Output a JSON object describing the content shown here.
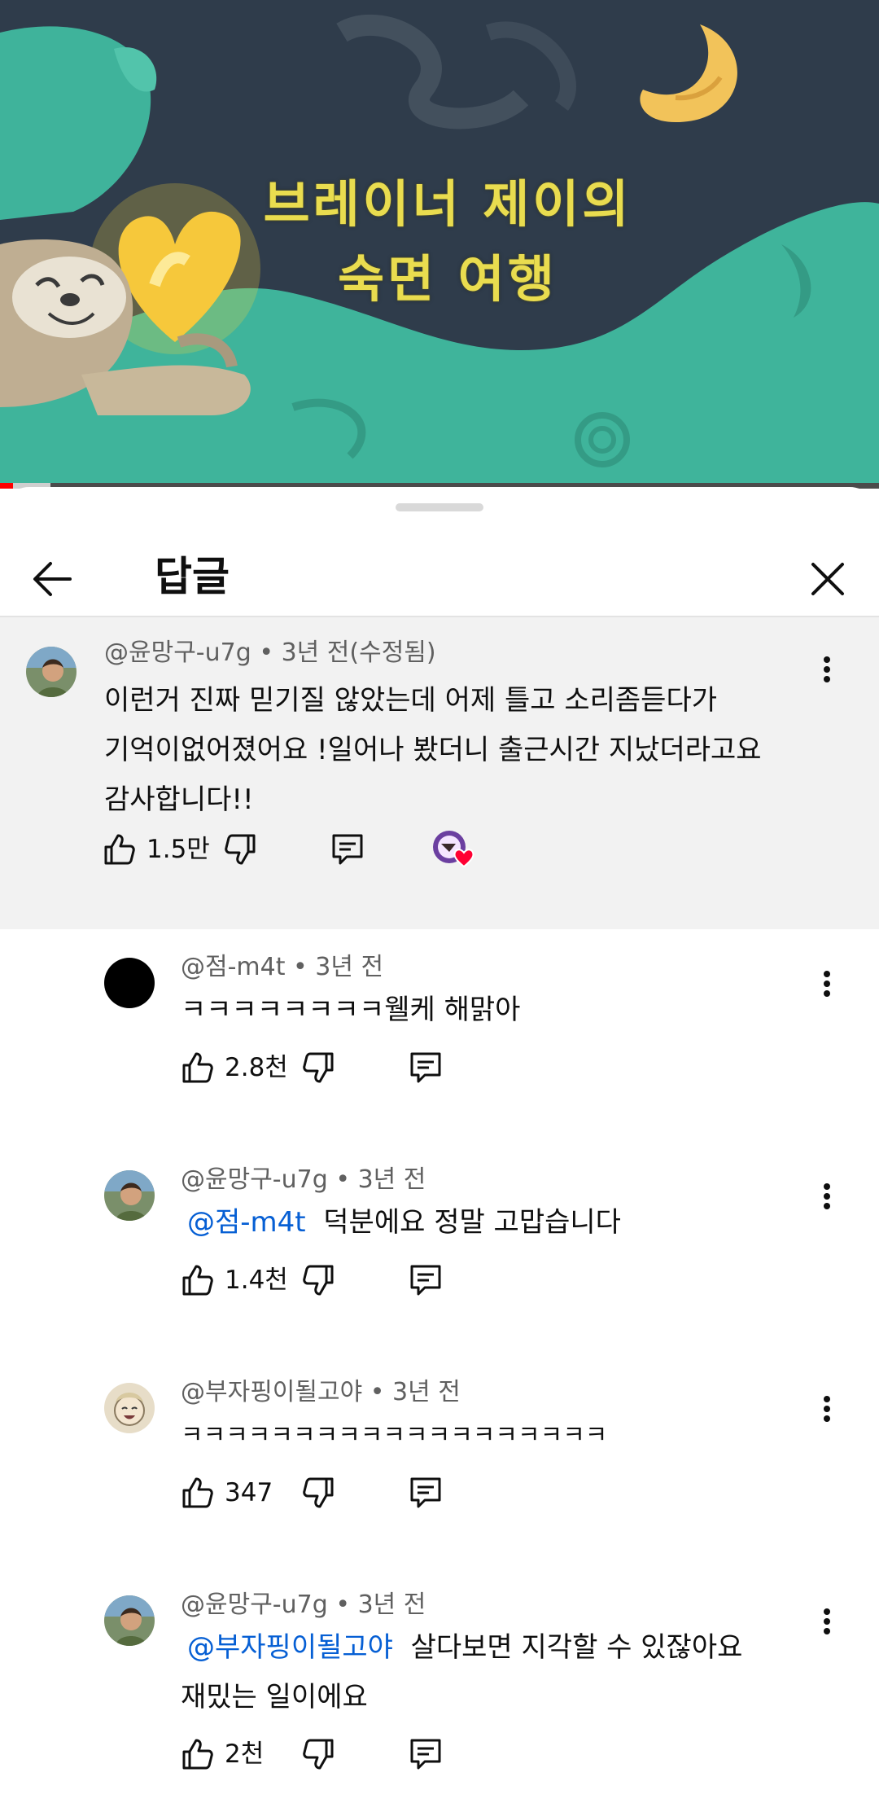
{
  "video": {
    "title_line1": "브레이너 제이의",
    "title_line2": "숙면 여행",
    "progress_percent": 2
  },
  "sheet": {
    "title": "답글"
  },
  "parent_comment": {
    "author": "@윤망구-u7g",
    "time": "3년 전(수정됨)",
    "lines": [
      "이런거 진짜 믿기질 않았는데 어제 틀고 소리좀듣다가",
      "기억이없어졌어요 !일어나 봤더니 출근시간 지났더라고요",
      "감사합니다!!"
    ],
    "likes": "1.5만"
  },
  "replies": [
    {
      "author": "@점-m4t",
      "time": "3년 전",
      "mention": "",
      "line1": "ㅋㅋㅋㅋㅋㅋㅋㅋ웰케 해맑아",
      "line2": "",
      "likes": "2.8천"
    },
    {
      "author": "@윤망구-u7g",
      "time": "3년 전",
      "mention": "@점-m4t",
      "line1": "덕분에요 정말 고맙습니다",
      "line2": "",
      "likes": "1.4천"
    },
    {
      "author": "@부자핑이될고야",
      "time": "3년 전",
      "mention": "",
      "line1": "ㅋㅋㅋㅋㅋㅋㅋㅋㅋㅋㅋㅋㅋㅋㅋㅋㅋㅋㅋ",
      "line2": "",
      "likes": "347"
    },
    {
      "author": "@윤망구-u7g",
      "time": "3년 전",
      "mention": "@부자핑이될고야",
      "line1": "살다보면 지각할 수 있잖아요",
      "line2": "재밌는 일이에요",
      "likes": "2천"
    }
  ],
  "icons": {
    "back": "arrow-left-icon",
    "close": "close-icon",
    "like": "thumbs-up-icon",
    "dislike": "thumbs-down-icon",
    "reply": "reply-icon",
    "more": "more-vertical-icon",
    "creator_heart": "creator-heart-icon"
  },
  "colors": {
    "mention": "#065fd4",
    "heart": "#ff0033",
    "progress": "#ff0000",
    "highlight_bg": "#f2f2f2"
  }
}
